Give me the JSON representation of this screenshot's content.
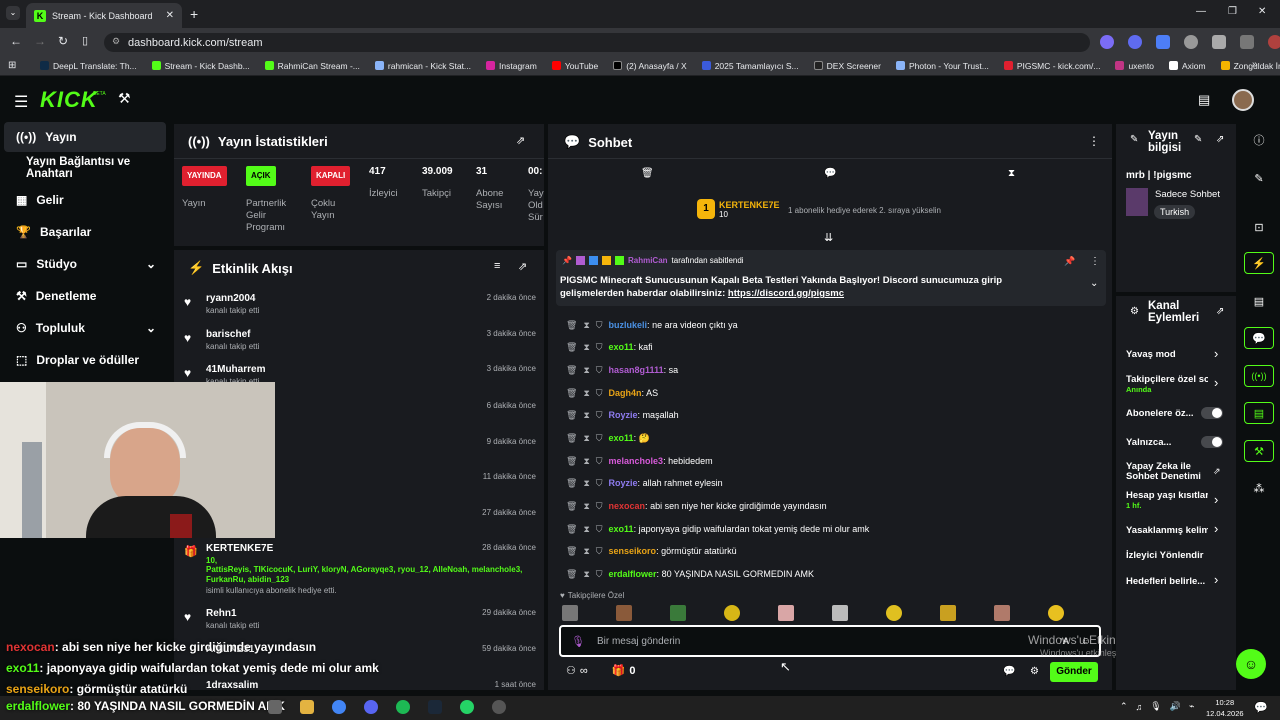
{
  "browser": {
    "tab_title": "Stream - Kick Dashboard",
    "url": "dashboard.kick.com/stream",
    "bookmarks": [
      "DeepL Translate: Th...",
      "Stream - Kick Dashb...",
      "RahmiCan Stream -...",
      "rahmican - Kick Stat...",
      "Instagram",
      "YouTube",
      "(2) Anasayfa / X",
      "2025 Tamamlayıcı S...",
      "DEX Screener",
      "Photon - Your Trust...",
      "PIGSMC - kick.com/...",
      "uxento",
      "Axiom",
      "Zonguldak İngilizce..."
    ]
  },
  "header": {
    "logo": "KICK",
    "beta": "BETA"
  },
  "sidebar": {
    "items": [
      {
        "label": "Yayın",
        "icon": "broadcast-icon"
      },
      {
        "label": "Yayın Bağlantısı ve Anahtarı",
        "icon": ""
      },
      {
        "label": "Gelir",
        "icon": "money-icon"
      },
      {
        "label": "Başarılar",
        "icon": "trophy-icon"
      },
      {
        "label": "Stüdyo",
        "icon": "studio-icon"
      },
      {
        "label": "Denetleme",
        "icon": "moderation-icon"
      },
      {
        "label": "Topluluk",
        "icon": "community-icon"
      },
      {
        "label": "Droplar ve ödüller",
        "icon": "drops-icon"
      }
    ]
  },
  "stats": {
    "title": "Yayın İstatistikleri",
    "items": [
      {
        "badge": "YAYINDA",
        "label": "Yayın",
        "color": "#e0202f"
      },
      {
        "badge": "AÇIK",
        "label": "Partnerlik Gelir Programı",
        "color": "#53fc18"
      },
      {
        "badge": "KAPALI",
        "label": "Çoklu Yayın",
        "color": "#e0202f"
      },
      {
        "value": "417",
        "label": "İzleyici"
      },
      {
        "value": "39.009",
        "label": "Takipçi"
      },
      {
        "value": "31",
        "label": "Abone Sayısı"
      },
      {
        "value": "00:",
        "label": "Yay Old Sür"
      }
    ]
  },
  "activity": {
    "title": "Etkinlik Akışı",
    "events": [
      {
        "user": "ryann2004",
        "action": "kanalı takip etti",
        "time": "2 dakika önce"
      },
      {
        "user": "barischef",
        "action": "kanalı takip etti",
        "time": "3 dakika önce"
      },
      {
        "user": "41Muharrem",
        "action": "kanalı takip etti",
        "time": "3 dakika önce"
      },
      {
        "time": "6 dakika önce"
      },
      {
        "time": "9 dakika önce"
      },
      {
        "time": "11 dakika önce"
      },
      {
        "time": "27 dakika önce"
      },
      {
        "user": "KERTENKE7E",
        "count": "10,",
        "recipients": "PattisReyis, TIKicocuK, LuriY, kloryN, AGorayqe3, ryou_12, AlleNoah, melanchole3, FurkanRu, abidin_123",
        "action": "isimli kullanıcıya abonelik hediye etti.",
        "time": "28 dakika önce"
      },
      {
        "user": "Rehn1",
        "action": "kanalı takip etti",
        "time": "29 dakika önce"
      },
      {
        "user": "ANILKE31",
        "time": "59 dakika önce"
      },
      {
        "user": "1draxsalim",
        "time": "1 saat önce"
      }
    ]
  },
  "chat": {
    "title": "Sohbet",
    "gifter": {
      "name": "KERTENKE7E",
      "count": "10",
      "rank": "1",
      "message": "1 abonelik hediye ederek 2. sıraya yükselin"
    },
    "pinned": {
      "by": "RahmiCan",
      "by_suffix": "tarafından sabitlendi",
      "text": "PIGSMC Minecraft Sunucusunun Kapalı Beta Testleri Yakında Başlıyor! Discord sunucumuza girip gelişmelerden haberdar olabilirsiniz:",
      "link": "https://discord.gg/pigsmc"
    },
    "messages": [
      {
        "user": "buzlukeli",
        "color": "#4a90e2",
        "text": "ne ara videon çıktı ya"
      },
      {
        "user": "exo11",
        "color": "#53fc18",
        "text": "kafi"
      },
      {
        "user": "hasan8g1111",
        "color": "#b05cd1",
        "text": "sa"
      },
      {
        "user": "Dagh4n",
        "color": "#e8a316",
        "text": "AS"
      },
      {
        "user": "Royzie",
        "color": "#8e7cf0",
        "text": "maşallah"
      },
      {
        "user": "exo11",
        "color": "#53fc18",
        "text": "🤔"
      },
      {
        "user": "melanchole3",
        "color": "#d65ad8",
        "text": "hebidedem"
      },
      {
        "user": "Royzie",
        "color": "#8e7cf0",
        "text": "allah rahmet eylesin"
      },
      {
        "user": "nexocan",
        "color": "#e03434",
        "text": "abi sen niye her kicke girdiğimde yayındasın"
      },
      {
        "user": "exo11",
        "color": "#53fc18",
        "text": "japonyaya gidip waifulardan tokat yemiş dede mi olur amk"
      },
      {
        "user": "senseikoro",
        "color": "#e8a316",
        "text": "görmüştür atatürkü"
      },
      {
        "user": "erdalflower",
        "color": "#53fc18",
        "text": "80 YAŞINDA NASIL GORMEDIN AMK"
      }
    ],
    "followers_only": "Takipçilere Özel",
    "input_placeholder": "Bir mesaj gönderin",
    "send_label": "Gönder",
    "points": "0",
    "infinity": "∞"
  },
  "stream_info": {
    "title": "Yayın bilgisi",
    "stream_title": "mrb | !pigsmc",
    "category": "Sadece Sohbet",
    "tag": "Turkish"
  },
  "channel_actions": {
    "title": "Kanal Eylemleri",
    "items": [
      {
        "label": "Yavaş mod",
        "type": "arrow"
      },
      {
        "label": "Takipçilere özel so",
        "sub": "Anında",
        "type": "arrow"
      },
      {
        "label": "Abonelere öz...",
        "type": "toggle"
      },
      {
        "label": "Yalnızca...",
        "type": "toggle"
      },
      {
        "label": "Yapay Zeka ile Sohbet Denetimi",
        "type": "link"
      },
      {
        "label": "Hesap yaşı kısıtlar",
        "sub": "1 hf.",
        "type": "arrow"
      },
      {
        "label": "Yasaklanmış kelim",
        "type": "arrow"
      },
      {
        "label": "İzleyici Yönlendir",
        "type": "none"
      },
      {
        "label": "Hedefleri belirle...",
        "type": "arrow"
      }
    ]
  },
  "overlay": {
    "lines": [
      {
        "user": "nexocan",
        "color": "#e03434",
        "text": ": abi sen niye her kicke girdiğimde yayındasın"
      },
      {
        "user": "exo11",
        "color": "#53fc18",
        "text": ": japonyaya gidip waifulardan tokat yemiş dede mi olur amk"
      },
      {
        "user": "senseikoro",
        "color": "#e8a316",
        "text": ": görmüştür atatürkü"
      },
      {
        "user": "erdalflower",
        "color": "#53fc18",
        "text": ": 80 YAŞINDA NASIL GORMEDİN AMK"
      }
    ]
  },
  "windows": {
    "activate_title": "Windows'u Etkinleştir",
    "activate_sub": "Windows'u etkinleştirmek için Ayarlar'a gidin.",
    "time": "10:28",
    "date": "12.04.2026"
  }
}
